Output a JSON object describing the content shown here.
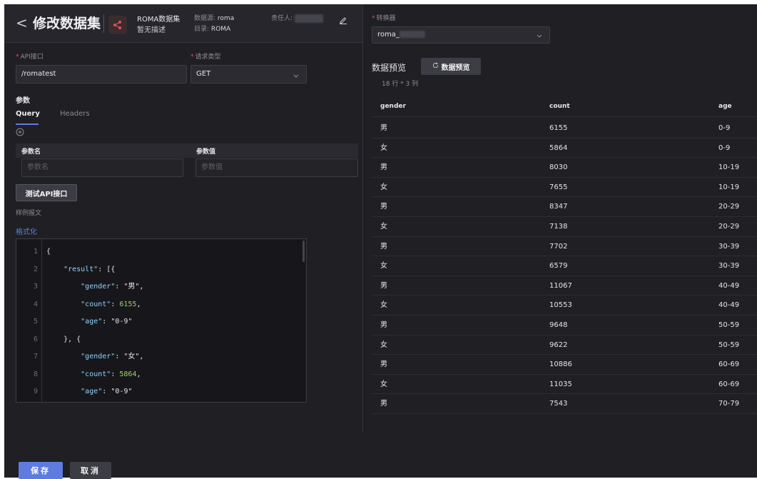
{
  "header": {
    "back_glyph": "<",
    "title": "修改数据集",
    "dataset_name": "ROMA数据集",
    "dataset_desc": "暂无描述",
    "datasource_label": "数据源:",
    "datasource_value": "roma",
    "catalog_label": "目录:",
    "catalog_value": "ROMA",
    "owner_label": "责任人:"
  },
  "form": {
    "api_label": "API接口",
    "api_value": "/romatest",
    "method_label": "请求类型",
    "method_value": "GET",
    "params_label": "参数",
    "tabs": [
      {
        "label": "Query"
      },
      {
        "label": "Headers"
      }
    ],
    "param_name_head": "参数名",
    "param_value_head": "参数值",
    "param_name_placeholder": "参数名",
    "param_value_placeholder": "参数值",
    "test_button": "测试API接口",
    "sample_label": "样例报文",
    "format_link": "格式化"
  },
  "code": {
    "lines": [
      {
        "n": "1",
        "parts": [
          [
            "p",
            "{"
          ]
        ]
      },
      {
        "n": "2",
        "parts": [
          [
            "k",
            "    \"result\""
          ],
          [
            "p",
            ": [{"
          ]
        ]
      },
      {
        "n": "3",
        "parts": [
          [
            "k",
            "        \"gender\""
          ],
          [
            "p",
            ": \"男\","
          ]
        ]
      },
      {
        "n": "4",
        "parts": [
          [
            "k",
            "        \"count\""
          ],
          [
            "p",
            ": "
          ],
          [
            "n",
            "6155"
          ],
          [
            "p",
            ","
          ]
        ]
      },
      {
        "n": "5",
        "parts": [
          [
            "k",
            "        \"age\""
          ],
          [
            "p",
            ": \"0-9\""
          ]
        ]
      },
      {
        "n": "6",
        "parts": [
          [
            "p",
            "    }, {"
          ]
        ]
      },
      {
        "n": "7",
        "parts": [
          [
            "k",
            "        \"gender\""
          ],
          [
            "p",
            ": \"女\","
          ]
        ]
      },
      {
        "n": "8",
        "parts": [
          [
            "k",
            "        \"count\""
          ],
          [
            "p",
            ": "
          ],
          [
            "n",
            "5864"
          ],
          [
            "p",
            ","
          ]
        ]
      },
      {
        "n": "9",
        "parts": [
          [
            "k",
            "        \"age\""
          ],
          [
            "p",
            ": \"0-9\""
          ]
        ]
      }
    ]
  },
  "footer": {
    "save": "保存",
    "cancel": "取消"
  },
  "right": {
    "converter_label": "转换器",
    "converter_value": "roma_",
    "preview_title": "数据预览",
    "preview_button": "数据预览",
    "rows_info": "18 行 * 3 列",
    "columns": [
      "gender",
      "count",
      "age"
    ],
    "rows": [
      [
        "男",
        "6155",
        "0-9"
      ],
      [
        "女",
        "5864",
        "0-9"
      ],
      [
        "男",
        "8030",
        "10-19"
      ],
      [
        "女",
        "7655",
        "10-19"
      ],
      [
        "男",
        "8347",
        "20-29"
      ],
      [
        "女",
        "7138",
        "20-29"
      ],
      [
        "男",
        "7702",
        "30-39"
      ],
      [
        "女",
        "6579",
        "30-39"
      ],
      [
        "男",
        "11067",
        "40-49"
      ],
      [
        "女",
        "10553",
        "40-49"
      ],
      [
        "男",
        "9648",
        "50-59"
      ],
      [
        "女",
        "9622",
        "50-59"
      ],
      [
        "男",
        "10886",
        "60-69"
      ],
      [
        "女",
        "11035",
        "60-69"
      ],
      [
        "男",
        "7543",
        "70-79"
      ]
    ]
  },
  "colors": {
    "accent": "#5e7ce0",
    "background": "#1f1f24",
    "required": "#e0505d"
  },
  "icons": [
    "chevron-left-icon",
    "share-icon",
    "edit-icon",
    "chevron-down-icon",
    "add-circle-icon",
    "refresh-icon"
  ]
}
